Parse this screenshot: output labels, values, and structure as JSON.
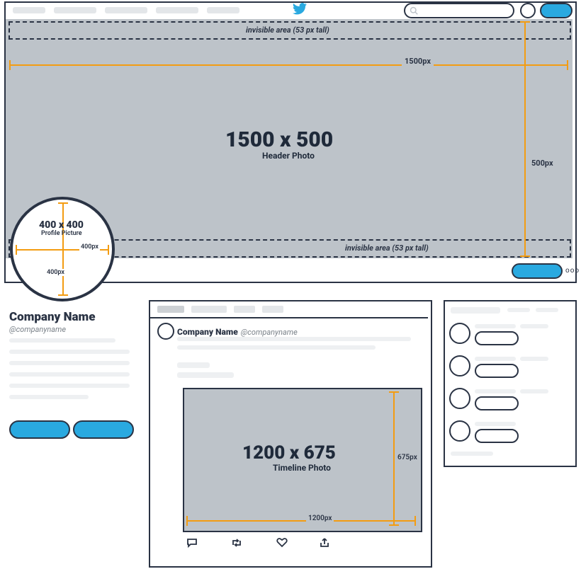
{
  "invisible_top": "invisible area (53 px tall)",
  "invisible_bottom": "invisible area (53 px tall)",
  "header": {
    "dim": "1500 x 500",
    "label": "Header Photo",
    "width_px": "1500px",
    "height_px": "500px"
  },
  "profile": {
    "dim": "400 x 400",
    "label": "Profile Picture",
    "width_px": "400px",
    "height_px": "400px"
  },
  "company": {
    "name": "Company Name",
    "handle": "@companyname"
  },
  "tweet": {
    "name": "Company Name",
    "handle": "@companyname"
  },
  "timeline": {
    "dim": "1200 x 675",
    "label": "Timeline Photo",
    "width_px": "1200px",
    "height_px": "675px"
  }
}
